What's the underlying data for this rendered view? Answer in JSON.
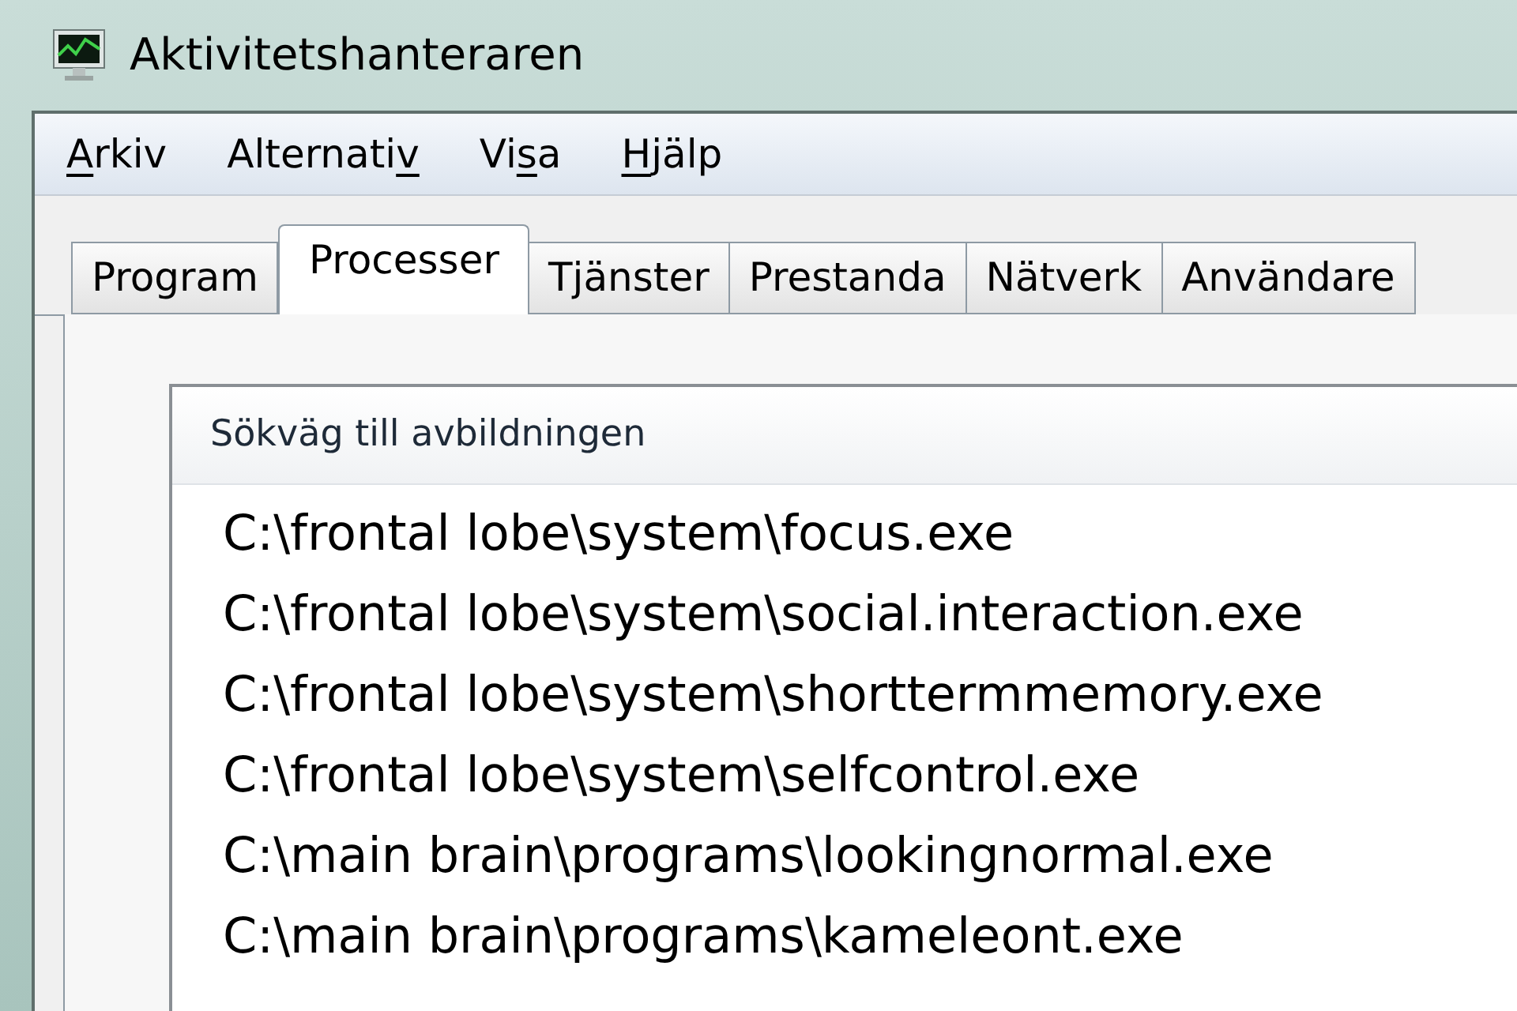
{
  "window": {
    "title": "Aktivitetshanteraren"
  },
  "menu": [
    {
      "key": "A",
      "after": "rkiv"
    },
    {
      "before": "Alternati",
      "key": "v"
    },
    {
      "before": "Vi",
      "key": "s",
      "after": "a"
    },
    {
      "key": "H",
      "after": "jälp"
    }
  ],
  "tabs": [
    {
      "label": "Program",
      "selected": false
    },
    {
      "label": "Processer",
      "selected": true
    },
    {
      "label": "Tjänster",
      "selected": false
    },
    {
      "label": "Prestanda",
      "selected": false
    },
    {
      "label": "Nätverk",
      "selected": false
    },
    {
      "label": "Användare",
      "selected": false
    }
  ],
  "table": {
    "columns": [
      "Sökväg till avbildningen"
    ],
    "rows": [
      "C:\\frontal lobe\\system\\focus.exe",
      "C:\\frontal lobe\\system\\social.interaction.exe",
      "C:\\frontal lobe\\system\\shorttermmemory.exe",
      "C:\\frontal lobe\\system\\selfcontrol.exe",
      "C:\\main brain\\programs\\lookingnormal.exe",
      "C:\\main brain\\programs\\kameleont.exe"
    ]
  }
}
